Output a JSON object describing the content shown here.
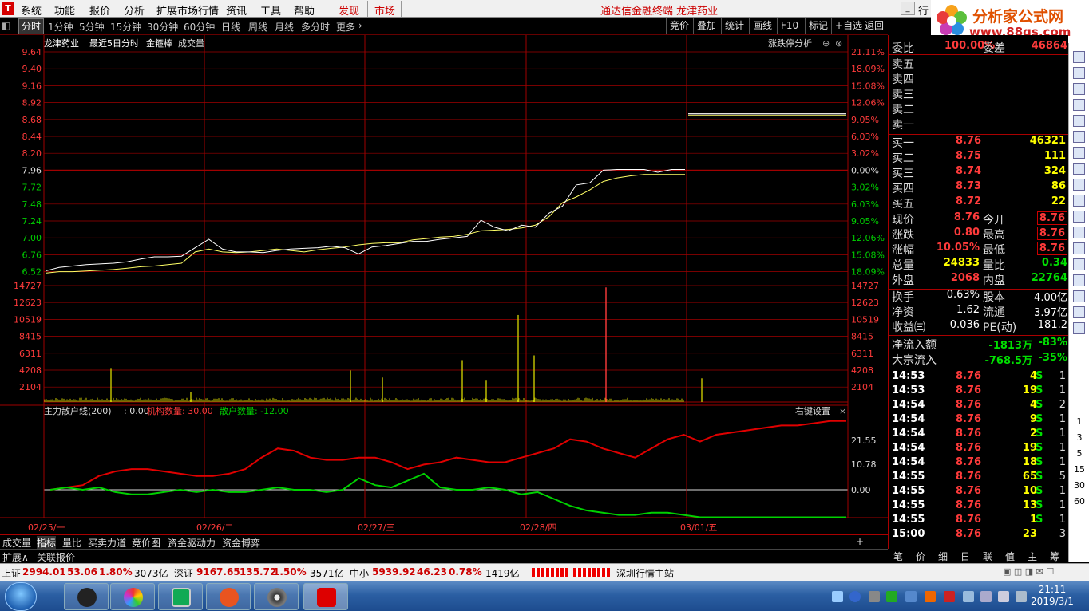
{
  "menu": {
    "items": [
      "系统",
      "功能",
      "报价",
      "分析",
      "扩展市场行情",
      "资讯",
      "工具",
      "帮助"
    ],
    "discover": "发现",
    "market": "市场",
    "title": "通达信金融终端  龙津药业",
    "hang": "行"
  },
  "brand": {
    "name": "分析家公式网",
    "url": "www.88gs.com"
  },
  "toolbar": {
    "periods": [
      "分时",
      "1分钟",
      "5分钟",
      "15分钟",
      "30分钟",
      "60分钟",
      "日线",
      "周线",
      "月线",
      "多分时",
      "更多"
    ],
    "right": [
      "竞价",
      "叠加",
      "统计",
      "画线",
      "F10",
      "标记",
      "+自选",
      "返回"
    ]
  },
  "chart_header": {
    "stock": "龙津药业",
    "mode": "最近5日分时",
    "indicator": "金箍棒",
    "volume": "成交量",
    "right": "涨跌停分析"
  },
  "chart_data": {
    "type": "line",
    "price_ticks": [
      "9.64",
      "9.40",
      "9.16",
      "8.92",
      "8.68",
      "8.44",
      "8.20",
      "7.96",
      "7.72",
      "7.48",
      "7.24",
      "7.00",
      "6.76",
      "6.52"
    ],
    "pct_ticks": [
      "21.11%",
      "18.09%",
      "15.08%",
      "12.06%",
      "9.05%",
      "6.03%",
      "3.02%",
      "0.00%",
      "3.02%",
      "6.03%",
      "9.05%",
      "12.06%",
      "15.08%",
      "18.09%"
    ],
    "volume_ticks": [
      "14727",
      "12623",
      "10519",
      "8415",
      "6311",
      "4208",
      "2104"
    ],
    "indicator_ticks": [
      "21.55",
      "10.78",
      "0.00"
    ],
    "x_labels": [
      "02/25/一",
      "02/26/二",
      "02/27/三",
      "02/28/四",
      "03/01/五"
    ],
    "price_series": [
      6.53,
      6.58,
      6.6,
      6.62,
      6.63,
      6.64,
      6.66,
      6.7,
      6.73,
      6.73,
      6.74,
      6.86,
      6.98,
      6.84,
      6.8,
      6.8,
      6.79,
      6.82,
      6.84,
      6.85,
      6.86,
      6.88,
      6.86,
      6.77,
      6.87,
      6.89,
      6.92,
      6.95,
      6.95,
      6.98,
      7.0,
      7.02,
      7.25,
      7.15,
      7.1,
      7.18,
      7.15,
      7.35,
      7.45,
      7.75,
      7.78,
      7.96,
      7.97,
      7.97,
      7.97,
      7.93,
      7.97,
      7.97,
      8.76,
      8.76
    ],
    "avg_series": [
      6.5,
      6.52,
      6.52,
      6.53,
      6.54,
      6.55,
      6.57,
      6.59,
      6.6,
      6.62,
      6.64,
      6.8,
      6.84,
      6.8,
      6.79,
      6.8,
      6.82,
      6.84,
      6.82,
      6.8,
      6.83,
      6.85,
      6.87,
      6.9,
      6.92,
      6.93,
      6.93,
      6.97,
      6.99,
      7.01,
      7.02,
      7.05,
      7.1,
      7.11,
      7.12,
      7.14,
      7.18,
      7.3,
      7.5,
      7.58,
      7.68,
      7.8,
      7.85,
      7.88,
      7.9,
      7.9,
      7.9,
      7.9,
      8.76,
      8.76
    ],
    "indicator": {
      "name": "主力散户线(200)",
      "value": "0.00",
      "inst_label": "机构数量",
      "inst_value": "30.00",
      "retail_label": "散户数量",
      "retail_value": "-12.00"
    },
    "inst_series": [
      0,
      1,
      2,
      6,
      8,
      9,
      9,
      8,
      7,
      6,
      6,
      7,
      9,
      14,
      18,
      17,
      14,
      13,
      13,
      14,
      14,
      12,
      9,
      11,
      12,
      14,
      13,
      12,
      12,
      14,
      16,
      18,
      22,
      21,
      18,
      16,
      14,
      18,
      22,
      24,
      21,
      24,
      25,
      26,
      27,
      28,
      28,
      29,
      30,
      30
    ],
    "retail_series": [
      0,
      1,
      0,
      1,
      -1,
      -2,
      -2,
      -1,
      0,
      -1,
      0,
      -1,
      -1,
      0,
      1,
      0,
      0,
      -1,
      0,
      5,
      2,
      1,
      4,
      7,
      1,
      0,
      0,
      1,
      0,
      -2,
      -1,
      -4,
      -7,
      -9,
      -10,
      -11,
      -11,
      -10,
      -10,
      -11,
      -12,
      -12,
      -12,
      -12,
      -12,
      -12,
      -12,
      -12,
      -12,
      -12
    ],
    "vol_spikes": [
      {
        "i": 8,
        "v": 4300
      },
      {
        "i": 18,
        "v": 1300
      },
      {
        "i": 38,
        "v": 4000
      },
      {
        "i": 42,
        "v": 3100
      },
      {
        "i": 52,
        "v": 5300
      },
      {
        "i": 55,
        "v": 2700
      },
      {
        "i": 59,
        "v": 11000
      },
      {
        "i": 61,
        "v": 5900
      },
      {
        "i": 70,
        "v": 14500
      },
      {
        "i": 82,
        "v": 3000
      }
    ]
  },
  "right_panel": {
    "weibi": {
      "label": "委比",
      "value": "100.00%",
      "label2": "委差",
      "value2": "46864"
    },
    "sells": [
      "卖五",
      "卖四",
      "卖三",
      "卖二",
      "卖一"
    ],
    "buys": [
      {
        "label": "买一",
        "price": "8.76",
        "vol": "46321"
      },
      {
        "label": "买二",
        "price": "8.75",
        "vol": "111"
      },
      {
        "label": "买三",
        "price": "8.74",
        "vol": "324"
      },
      {
        "label": "买四",
        "price": "8.73",
        "vol": "86"
      },
      {
        "label": "买五",
        "price": "8.72",
        "vol": "22"
      }
    ],
    "quote": [
      {
        "l1": "现价",
        "v1": "8.76",
        "l2": "今开",
        "v2": "8.76"
      },
      {
        "l1": "涨跌",
        "v1": "0.80",
        "l2": "最高",
        "v2": "8.76"
      },
      {
        "l1": "涨幅",
        "v1": "10.05%",
        "l2": "最低",
        "v2": "8.76"
      },
      {
        "l1": "总量",
        "v1": "24833",
        "l2": "量比",
        "v2": "0.34"
      },
      {
        "l1": "外盘",
        "v1": "2068",
        "l2": "内盘",
        "v2": "22764"
      }
    ],
    "stats": [
      {
        "l1": "换手",
        "v1": "0.63%",
        "l2": "股本",
        "v2": "4.00亿"
      },
      {
        "l1": "净资",
        "v1": "1.62",
        "l2": "流通",
        "v2": "3.97亿"
      },
      {
        "l1": "收益㈢",
        "v1": "0.036",
        "l2": "PE(动)",
        "v2": "181.2"
      }
    ],
    "flows": [
      {
        "label": "净流入额",
        "amount": "-1813万",
        "pct": "-83%"
      },
      {
        "label": "大宗流入",
        "amount": "-768.5万",
        "pct": "-35%"
      }
    ],
    "ticks": [
      {
        "t": "14:53",
        "p": "8.76",
        "v": "4",
        "s": "S",
        "n": "1"
      },
      {
        "t": "14:53",
        "p": "8.76",
        "v": "19",
        "s": "S",
        "n": "1"
      },
      {
        "t": "14:54",
        "p": "8.76",
        "v": "4",
        "s": "S",
        "n": "2"
      },
      {
        "t": "14:54",
        "p": "8.76",
        "v": "9",
        "s": "S",
        "n": "1"
      },
      {
        "t": "14:54",
        "p": "8.76",
        "v": "2",
        "s": "S",
        "n": "1"
      },
      {
        "t": "14:54",
        "p": "8.76",
        "v": "19",
        "s": "S",
        "n": "1"
      },
      {
        "t": "14:54",
        "p": "8.76",
        "v": "18",
        "s": "S",
        "n": "1"
      },
      {
        "t": "14:55",
        "p": "8.76",
        "v": "65",
        "s": "S",
        "n": "5"
      },
      {
        "t": "14:55",
        "p": "8.76",
        "v": "10",
        "s": "S",
        "n": "1"
      },
      {
        "t": "14:55",
        "p": "8.76",
        "v": "13",
        "s": "S",
        "n": "1"
      },
      {
        "t": "14:55",
        "p": "8.76",
        "v": "1",
        "s": "S",
        "n": "1"
      },
      {
        "t": "15:00",
        "p": "8.76",
        "v": "23",
        "s": "",
        "n": "3"
      }
    ],
    "tabs": [
      "笔",
      "价",
      "细",
      "日",
      "联",
      "值",
      "主",
      "筹"
    ]
  },
  "bottom_tabs": [
    "成交量",
    "指标",
    "量比",
    "买卖力道",
    "竞价图",
    "资金驱动力",
    "资金博弈"
  ],
  "expand": {
    "expand": "扩展∧",
    "related": "关联报价"
  },
  "right_set": "右键设置",
  "status": {
    "sh": {
      "label": "上证",
      "price": "2994.01",
      "chg": "53.06",
      "pct": "1.80%",
      "amt": "3073亿"
    },
    "sz": {
      "label": "深证",
      "price": "9167.65",
      "chg": "135.72",
      "pct": "1.50%",
      "amt": "3571亿"
    },
    "zx": {
      "label": "中小",
      "price": "5939.92",
      "chg": "46.23",
      "pct": "0.78%",
      "amt": "1419亿"
    },
    "server": "深圳行情主站"
  },
  "tools_nums": [
    "1",
    "3",
    "5",
    "15",
    "30",
    "60"
  ],
  "clock": {
    "time": "21:11",
    "date": "2019/3/1"
  },
  "colors": {
    "red": "#ff3b3b",
    "grid": "#a00000",
    "price": "#ffffff",
    "avg": "#ffff66",
    "vol": "#c8c800",
    "inst": "#e00000",
    "retail": "#00d000",
    "yellow": "#ffff00",
    "green": "#00e000"
  }
}
